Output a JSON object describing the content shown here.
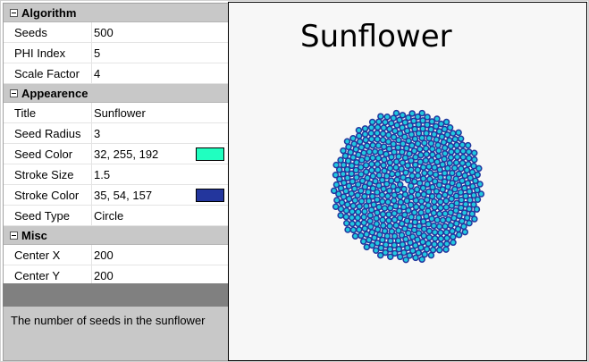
{
  "grid": {
    "sections": [
      {
        "title": "Algorithm",
        "rows": [
          {
            "label": "Seeds",
            "value": "500"
          },
          {
            "label": "PHI Index",
            "value": "5"
          },
          {
            "label": "Scale Factor",
            "value": "4"
          }
        ]
      },
      {
        "title": "Appearence",
        "rows": [
          {
            "label": "Title",
            "value": "Sunflower"
          },
          {
            "label": "Seed Radius",
            "value": "3"
          },
          {
            "label": "Seed Color",
            "value": "32, 255, 192",
            "swatch": "#20ffc0"
          },
          {
            "label": "Stroke Size",
            "value": "1.5"
          },
          {
            "label": "Stroke Color",
            "value": "35, 54, 157",
            "swatch": "#23369d"
          },
          {
            "label": "Seed Type",
            "value": "Circle"
          }
        ]
      },
      {
        "title": "Misc",
        "rows": [
          {
            "label": "Center X",
            "value": "200"
          },
          {
            "label": "Center Y",
            "value": "200"
          }
        ]
      }
    ]
  },
  "description": "The number of seeds in the sunflower",
  "canvas": {
    "title": "Sunflower",
    "seeds": 500,
    "scale": 4,
    "seed_radius": 3,
    "seed_fill": "#20c8e0",
    "seed_stroke": "#23369d",
    "stroke_size": 1.5
  }
}
